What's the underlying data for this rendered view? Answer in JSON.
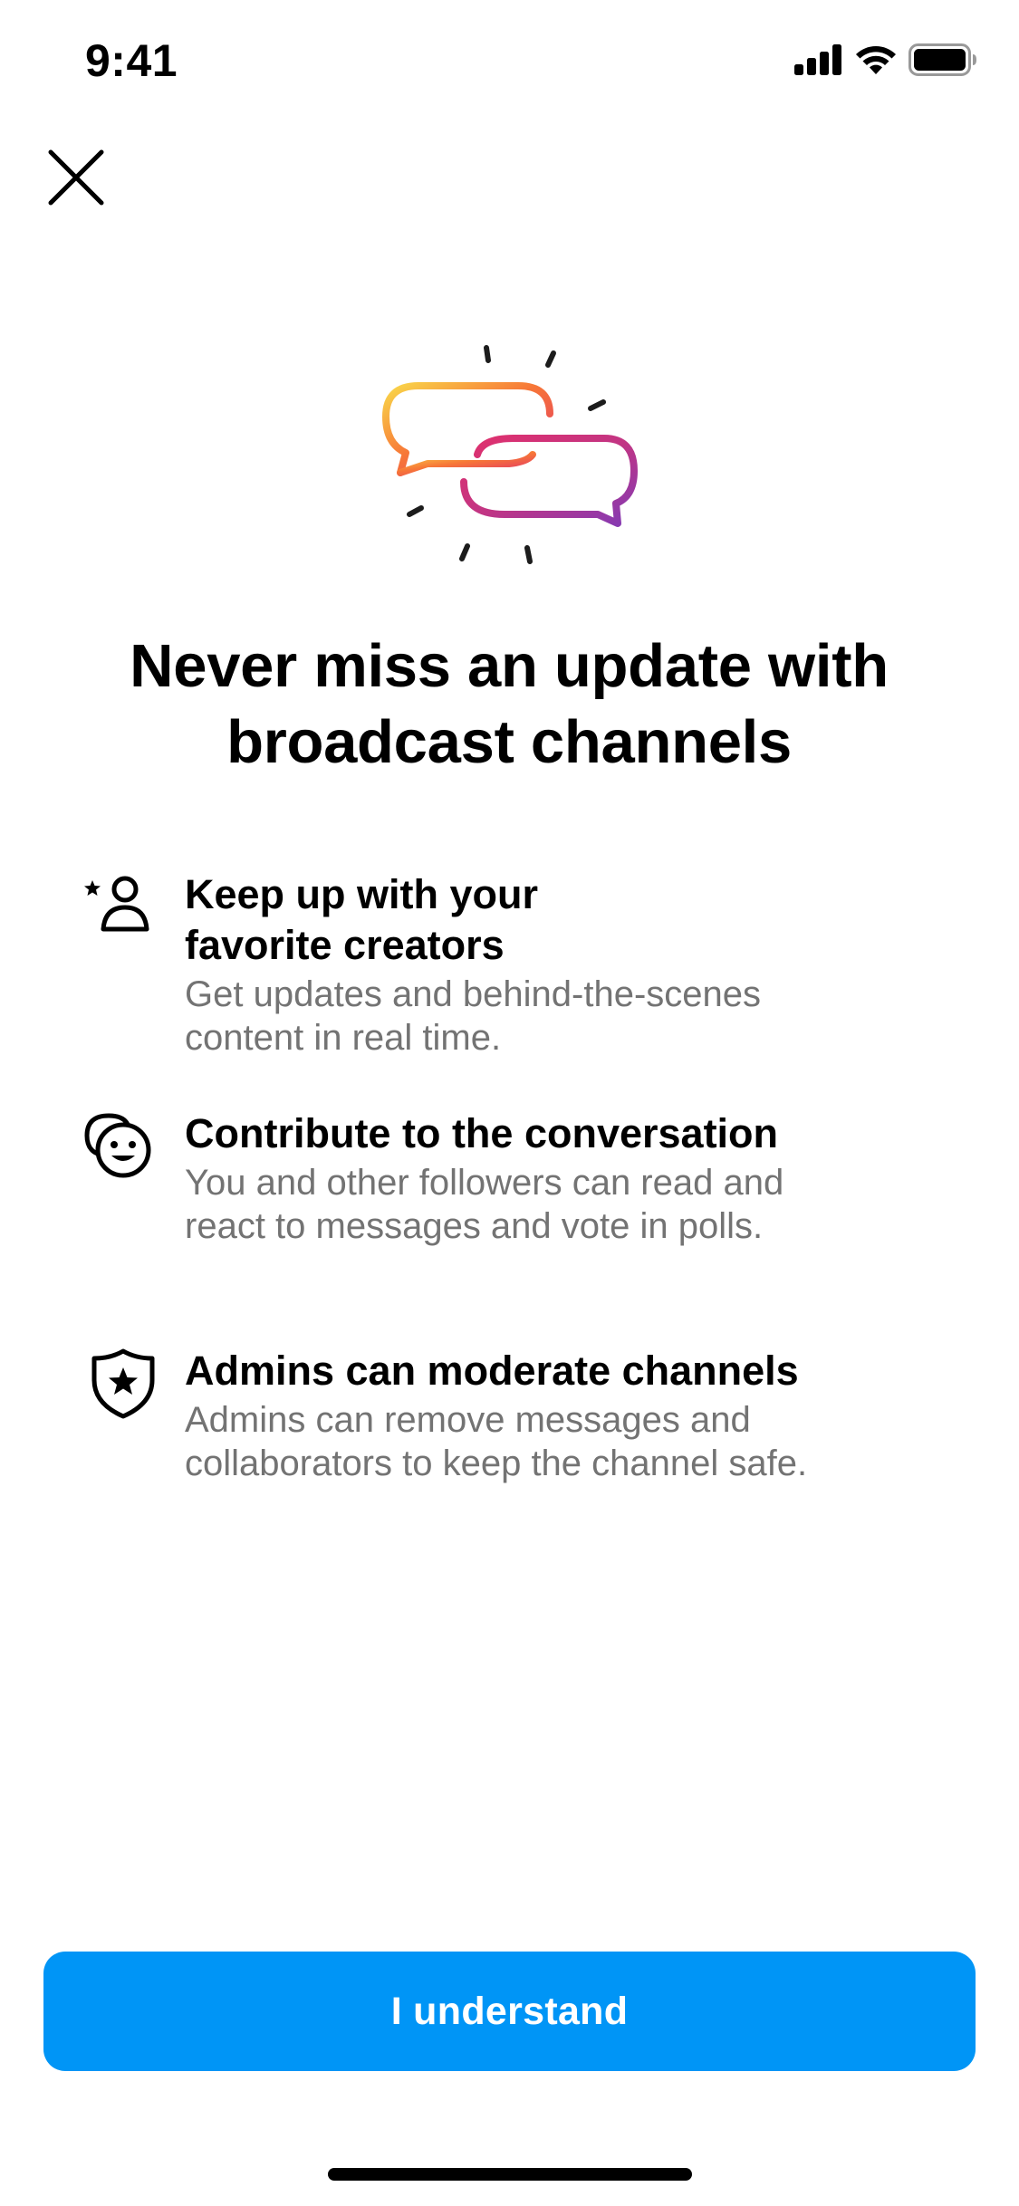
{
  "status_bar": {
    "time": "9:41",
    "icons": [
      "cellular-signal-icon",
      "wifi-icon",
      "battery-icon"
    ]
  },
  "header": {
    "close_icon": "close-icon"
  },
  "hero": {
    "icon": "broadcast-chat-bubbles-icon",
    "gradient_colors": [
      "#f9d84a",
      "#f77737",
      "#e1306c",
      "#c13584",
      "#833ab4"
    ]
  },
  "title": {
    "line1": "Never miss an update with",
    "line2": "broadcast channels"
  },
  "features": [
    {
      "icon": "star-person-icon",
      "title_line1": "Keep up with your",
      "title_line2": "favorite creators",
      "desc_line1": "Get updates and behind-the-scenes",
      "desc_line2": "content in real time."
    },
    {
      "icon": "chat-smiley-icon",
      "title_line1": "Contribute to the conversation",
      "desc_line1": "You and other followers can read and",
      "desc_line2": "react to messages and vote in polls."
    },
    {
      "icon": "shield-star-icon",
      "title_line1": "Admins can moderate channels",
      "desc_line1": "Admins can remove messages and",
      "desc_line2": "collaborators to keep the channel safe."
    }
  ],
  "cta": {
    "label": "I understand",
    "color": "#0095f6"
  },
  "colors": {
    "text_primary": "#000000",
    "text_secondary": "#737373",
    "background": "#ffffff"
  }
}
